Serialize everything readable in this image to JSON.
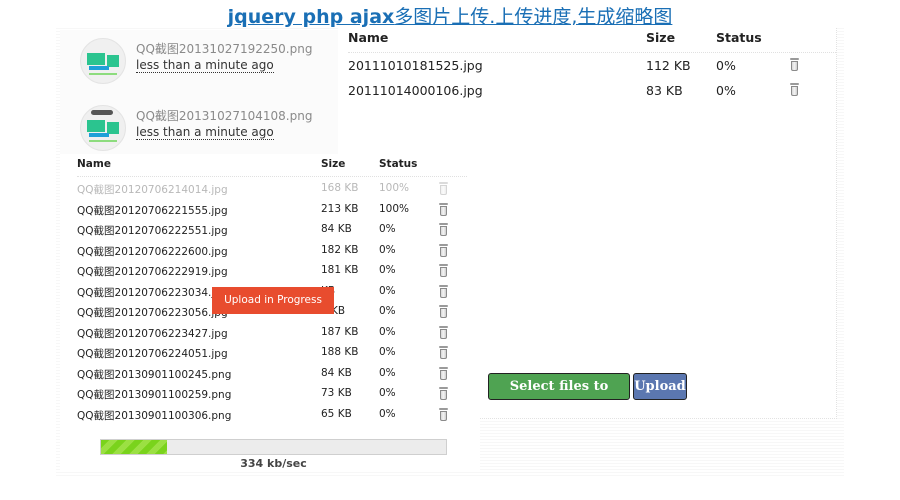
{
  "page": {
    "title_en": "jquery php ajax",
    "title_cn": "多图片上传.上传进度,生成缩略图"
  },
  "colors": {
    "title_link": "#1a6fb5",
    "select_button": "#4fa352",
    "upload_button": "#5b77b0",
    "toast": "#e84c2e",
    "progress_fill": "#7ad31c"
  },
  "uploaded_thumbnails": [
    {
      "filename": "QQ截图20131027192250.png",
      "time": "less than a minute ago"
    },
    {
      "filename": "QQ截图20131027104108.png",
      "time": "less than a minute ago"
    }
  ],
  "queue_main": {
    "columns": {
      "name": "Name",
      "size": "Size",
      "status": "Status"
    },
    "rows": [
      {
        "name": "20111010181525.jpg",
        "size": "112 KB",
        "status": "0%",
        "action_icon": "trash-icon"
      },
      {
        "name": "20111014000106.jpg",
        "size": "83 KB",
        "status": "0%",
        "action_icon": "trash-icon"
      }
    ]
  },
  "queue_demo": {
    "columns": {
      "name": "Name",
      "size": "Size",
      "status": "Status"
    },
    "rows": [
      {
        "name": "QQ截图20120706214014.jpg",
        "size": "168 KB",
        "status": "100%",
        "faded": true
      },
      {
        "name": "QQ截图20120706221555.jpg",
        "size": "213 KB",
        "status": "100%"
      },
      {
        "name": "QQ截图20120706222551.jpg",
        "size": "84 KB",
        "status": "0%"
      },
      {
        "name": "QQ截图20120706222600.jpg",
        "size": "182 KB",
        "status": "0%"
      },
      {
        "name": "QQ截图20120706222919.jpg",
        "size": "181 KB",
        "status": "0%"
      },
      {
        "name": "QQ截图20120706223034.jpg",
        "size": "KB",
        "status": "0%"
      },
      {
        "name": "QQ截图20120706223056.jpg",
        "size": "1 KB",
        "status": "0%"
      },
      {
        "name": "QQ截图20120706223427.jpg",
        "size": "187 KB",
        "status": "0%"
      },
      {
        "name": "QQ截图20120706224051.jpg",
        "size": "188 KB",
        "status": "0%"
      },
      {
        "name": "QQ截图20130901100245.png",
        "size": "84 KB",
        "status": "0%"
      },
      {
        "name": "QQ截图20130901100259.png",
        "size": "73 KB",
        "status": "0%"
      },
      {
        "name": "QQ截图20130901100306.png",
        "size": "65 KB",
        "status": "0%"
      }
    ]
  },
  "toast": {
    "text": "Upload in Progress"
  },
  "progress": {
    "fraction": 0.19,
    "speed": "334 kb/sec"
  },
  "buttons": {
    "select": "Select files to upload",
    "upload": "Upload"
  }
}
